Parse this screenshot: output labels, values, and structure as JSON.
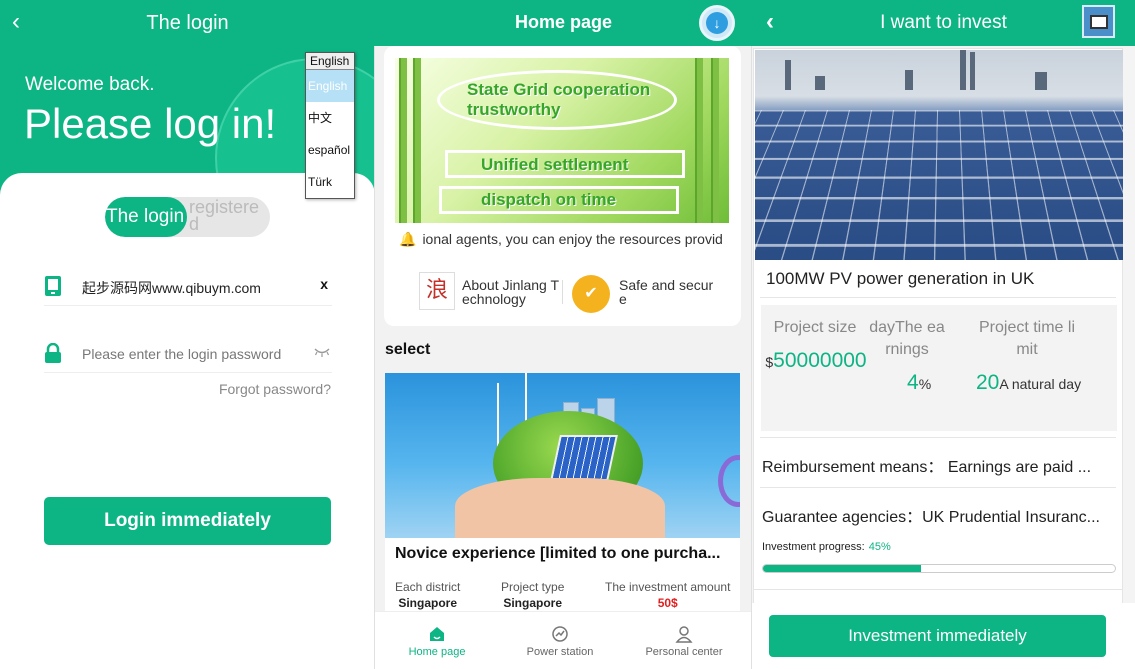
{
  "login": {
    "header_title": "The login",
    "welcome": "Welcome back.",
    "headline": "Please log in!",
    "tab_login": "The login",
    "tab_register": "registered",
    "username_value": "起步源码网www.qibuym.com",
    "clear_icon": "x",
    "password_placeholder": "Please enter the login password",
    "forgot": "Forgot password?",
    "login_button": "Login immediately",
    "language_select": {
      "selected": "English",
      "options": [
        "English",
        "中文",
        "español",
        "Türk"
      ]
    },
    "colors": {
      "primary": "#0db484"
    }
  },
  "home": {
    "header_title": "Home page",
    "banner_lines": [
      "State Grid cooperation",
      "trustworthy",
      "Unified settlement",
      "dispatch on time"
    ],
    "notice": "ional agents, you can enjoy the resources provid",
    "quick_about": "About Jinlang Technology",
    "quick_safe": "Safe and secure",
    "quick_logo_text": "浪",
    "section_title": "select",
    "project": {
      "name": "Novice experience [limited to one purcha...",
      "district_label": "Each district",
      "district_value": "Singapore",
      "type_label": "Project type",
      "type_value": "Singapore",
      "amount_label": "The investment amount",
      "amount_value": "50$"
    },
    "tabs": [
      "Home page",
      "Power station",
      "Personal center"
    ]
  },
  "invest": {
    "header_title": "I want to invest",
    "project_title": "100MW PV power generation in UK",
    "size_label": "Project size",
    "size_currency": "$",
    "size_value": "50000000",
    "earnings_label": "dayThe earnings",
    "earnings_value": "4",
    "earnings_unit": "%",
    "time_label": "Project time limit",
    "time_value": "20",
    "time_unit": "A natural day",
    "reimb_label": "Reimbursement means：",
    "reimb_value": "Earnings are paid ...",
    "guarantee_label": "Guarantee agencies：",
    "guarantee_value": "UK Prudential Insuranc...",
    "progress_label": "Investment progress:",
    "progress_text": "45%",
    "progress_fraction": 0.45,
    "invest_button": "Investment immediately"
  }
}
